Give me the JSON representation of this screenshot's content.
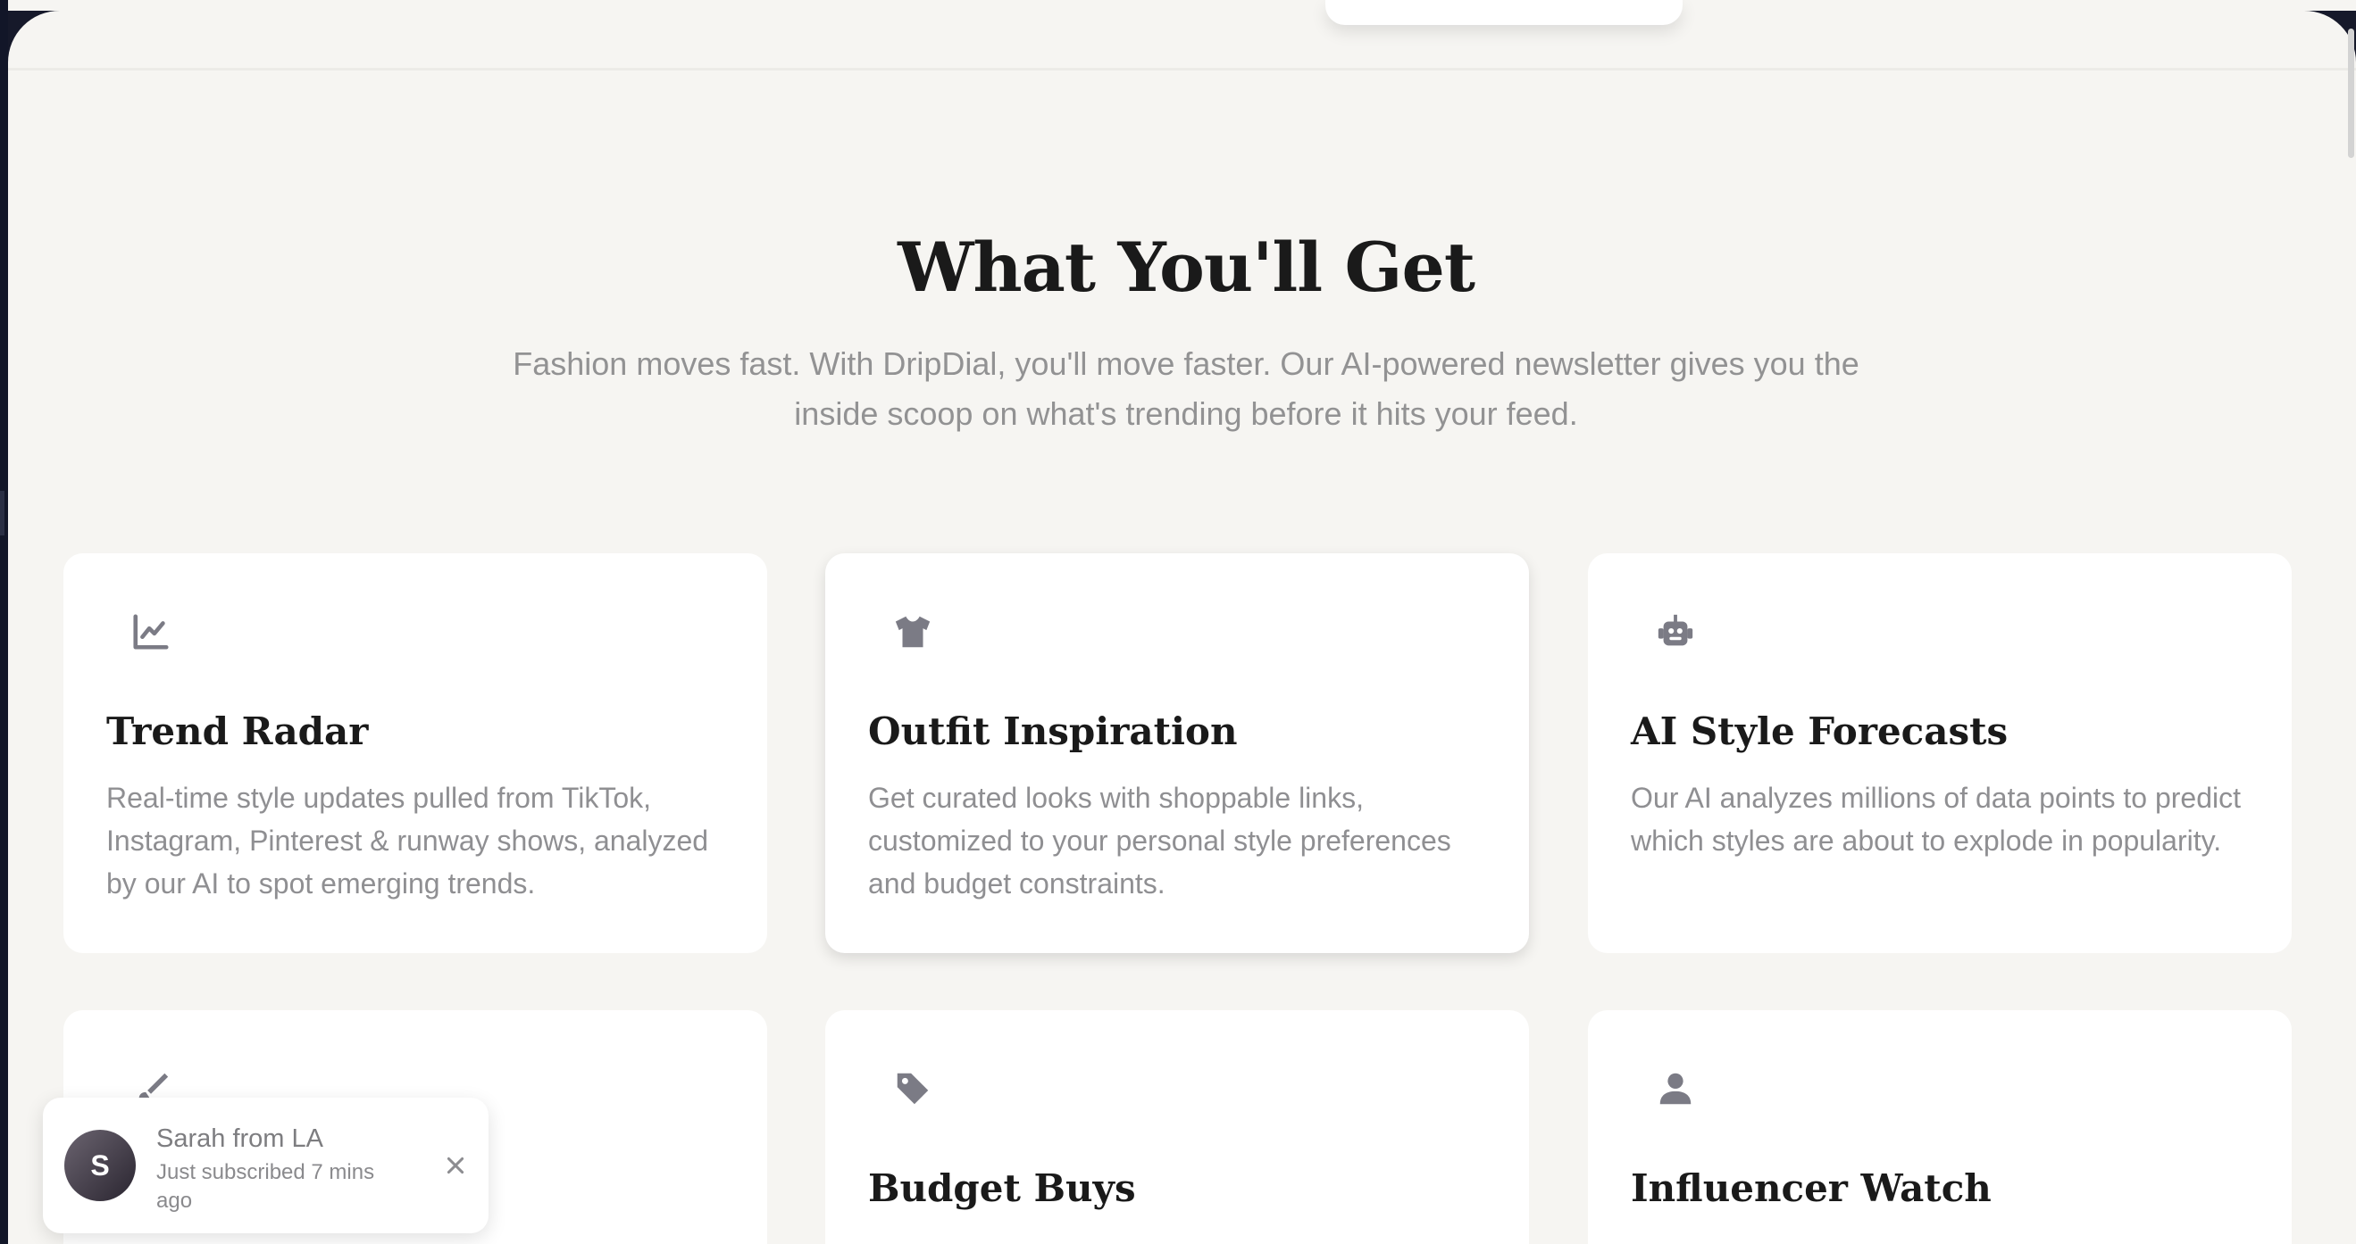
{
  "section": {
    "title": "What You'll Get",
    "subtitle": "Fashion moves fast. With DripDial, you'll move faster. Our AI-powered newsletter gives you the inside scoop on what's trending before it hits your feed."
  },
  "features": [
    {
      "icon": "chart-line-icon",
      "title": "Trend Radar",
      "description": "Real-time style updates pulled from TikTok, Instagram, Pinterest & runway shows, analyzed by our AI to spot emerging trends."
    },
    {
      "icon": "shirt-icon",
      "title": "Outfit Inspiration",
      "description": "Get curated looks with shoppable links, customized to your personal style preferences and budget constraints."
    },
    {
      "icon": "robot-icon",
      "title": "AI Style Forecasts",
      "description": "Our AI analyzes millions of data points to predict which styles are about to explode in popularity."
    },
    {
      "icon": "brush-icon",
      "title": "",
      "description": ""
    },
    {
      "icon": "tag-icon",
      "title": "Budget Buys",
      "description": ""
    },
    {
      "icon": "user-icon",
      "title": "Influencer Watch",
      "description": ""
    }
  ],
  "toast": {
    "avatar_initial": "S",
    "name": "Sarah from LA",
    "message": "Just subscribed 7 mins ago"
  },
  "colors": {
    "page_background": "#f6f5f2",
    "card_background": "#ffffff",
    "heading": "#1a1a1a",
    "body_text": "#929293",
    "icon": "#7b7b85"
  }
}
